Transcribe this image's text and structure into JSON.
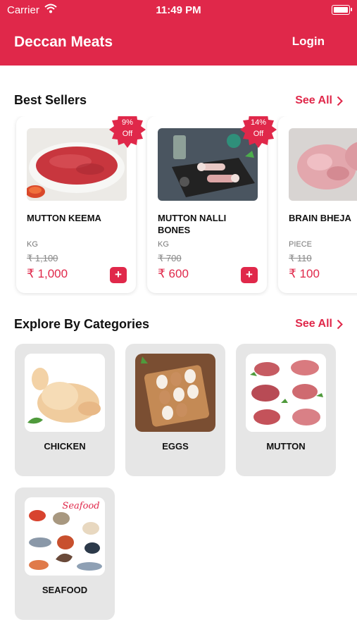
{
  "status_bar": {
    "carrier": "Carrier",
    "time": "11:49 PM"
  },
  "header": {
    "title": "Deccan Meats",
    "login": "Login"
  },
  "best_sellers": {
    "title": "Best Sellers",
    "see_all": "See All",
    "products": [
      {
        "name": "MUTTON KEEMA",
        "unit": "KG",
        "old_price": "₹ 1,100",
        "price": "₹ 1,000",
        "discount_pct": "9%",
        "discount_word": "Off"
      },
      {
        "name": "MUTTON NALLI BONES",
        "unit": "KG",
        "old_price": "₹ 700",
        "price": "₹ 600",
        "discount_pct": "14%",
        "discount_word": "Off"
      },
      {
        "name": "BRAIN BHEJA",
        "unit": "PIECE",
        "old_price": "₹ 110",
        "price": "₹ 100"
      }
    ],
    "add_symbol": "+"
  },
  "categories": {
    "title": "Explore By Categories",
    "see_all": "See All",
    "items": [
      {
        "label": "CHICKEN"
      },
      {
        "label": "EGGS"
      },
      {
        "label": "MUTTON"
      },
      {
        "label": "SEAFOOD",
        "image_text": "Seafood"
      }
    ]
  },
  "colors": {
    "accent": "#e0284a",
    "card_bg": "#e6e6e6"
  },
  "icons": {
    "wifi": "wifi-icon",
    "battery": "battery-icon",
    "chevron": "chevron-right-icon",
    "add": "plus-icon"
  }
}
